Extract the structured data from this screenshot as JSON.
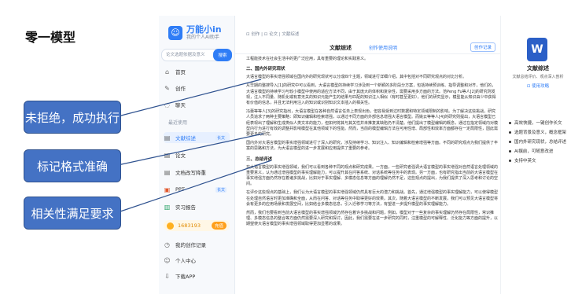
{
  "slide": {
    "title": "零一模型"
  },
  "app": {
    "logo_name": "万能小in",
    "logo_tagline": "我的个人AI助手",
    "search_placeholder": "论文选题依据及意义",
    "search_button": "搜索",
    "nav_top": [
      {
        "label": "首页",
        "icon": "home-icon"
      },
      {
        "label": "创作",
        "icon": "edit-icon"
      },
      {
        "label": "聊天",
        "icon": "chat-icon"
      }
    ],
    "recent_label": "最近使用",
    "recent_items": [
      {
        "label": "文献综述",
        "badge": "长文",
        "active": true
      },
      {
        "label": "论文",
        "badge": ""
      },
      {
        "label": "文档改写降重",
        "badge": ""
      },
      {
        "label": "PPT",
        "badge": "长文"
      },
      {
        "label": "实习报告",
        "badge": ""
      }
    ],
    "points": {
      "value": "1683193",
      "button": "充值"
    },
    "nav_bottom": [
      {
        "label": "我的创作记录"
      },
      {
        "label": "个人中心"
      },
      {
        "label": "下载APP"
      }
    ]
  },
  "doc": {
    "breadcrumb": "⊡ 创作  |  ⊡ 论文  |  文献综述",
    "title": "文献综述",
    "link": "创作使用说明",
    "action_button": "创作记录",
    "paragraphs": [
      {
        "kind": "p",
        "text": "工程能技术在社会生活中的更广泛应用，具有重要的理论和实践意义。"
      },
      {
        "kind": "h",
        "text": "二、国内外研究现状"
      },
      {
        "kind": "p",
        "text": "大语言模型的事实增强领域在国内外的研究现状可以分成四个主题，领域进行详细介绍，其中包括对不同研究观点的对比分析。"
      },
      {
        "kind": "p",
        "text": "从早期的整搜导入[1]的研究中可以看到，大语言模型的持续学习涉及到一个新颖的多阶段分方案，包括持续预训练、指导调整和对齐，他们的，大语言模型的持续学习与较小模型中使用的适应方法不同，由于其庞大的体积和复杂性，需要采用多方面的方法。范Peng Fu等人[2]的研究则发现，注入不同量、随机化或有意无关的知识元能产生的结果与匹配的知识注入相似（有时甚至更好），他们的研究显示，模型能从知识由少中获得有价值的信息，并且无法利用注入的知识或识别知识文本插入的相关性。"
      },
      {
        "kind": "p",
        "text": "冯蕾等等人[3]的研究指出，大语言模型在各种自然语言任务上表现出色，但容易受到过时数据和特定领域限制的影响。为了解决这些挑战，研究人员追求了两种主要策略：即知识编辑和检索增强，以通过不同方面的外部信息增强大语言模型。而姚云等等人[4]的研究则提出，大语言模型已经表现出了理解和生成类似人类文本的能力，但如何将其与其关性并未推复其缺陷仍不清楚。他们提出了模型编辑的概念，通过在指定领域内对模型内行为进行有效的调整并影响模型在其他领域下的性能。然而，当前的模型编辑方法在可用性增、局部性和效率方面都存在一定局限性，因此需要更多的研究。"
      },
      {
        "kind": "p",
        "text": "国内外对大语言模型的事实增强领域进行了深入的研究，涉及持续学习、知识注入、知识编辑和检索增强等方面。不同的研究观点为我们提供了丰富的思路和方法，为大语言模型的进一步发展和应用提供了重要的参考。"
      },
      {
        "kind": "h",
        "text": "三、总结评述"
      },
      {
        "kind": "p",
        "text": "在大语言模型的事实增强领域，我们可以看到各种不同的观点和研究成果。一方面，一些研究者强调大语言模型的事实增强对自然语言处理领域的重要意义，认为通过增强模型的事实理解能力，可以提升其在问答系统、对话系统等任务中的表现。另一方面，也有研究指出当前的大语言模型在事实增强方面仍然存在着诸多挑战，比如对于事实理解、多模态信息等方面的理解仍然不足，这些观点的提出，为我们提供了深入思考和讨论的空间。"
      },
      {
        "kind": "p",
        "text": "在评价这些观点的基础上，我们认为大语言模型的事实增强领域仍然具有巨大的潜力和挑战。首先，通过增强模型的事实理解能力，可以使得模型在处理自然语言时更加准确和全面，从而在问答、对话等任务中取得更好的效果。其次，随着大语言模型的不断发展，我们可以预见大语言模型将会有更多的应用场景和发展空间，比如结合多模态信息，引入迁移学习等方法，有望进一步提升模型的事实理解能力。"
      },
      {
        "kind": "p",
        "text": "然而，我们也要看到当前大语言模型的事实增强领域仍然存在着许多挑战和问题，例如，模型对于一些复杂的事实理解仍然存在局限性，常识推理、多模态信息的整合等方面仍然需要深入研究和探讨，因此，我们需要在进一步研究的同时，注重模型的可解释性、泛化能力等方面的提升，以期望使大语言模型的事实增强领域取得更加显著的成果。"
      }
    ]
  },
  "right_panel": {
    "icon": "word-icon",
    "title": "文献综述",
    "desc": "文献总结评价、观点深入剖析",
    "link": "⊡ 使用攻略",
    "features": [
      "高效快捷，一键创作长文",
      "选题背景及意义，概念框架",
      "国内外研究现状，总结评述",
      "AI撰前，可随意改进",
      "支持中英文"
    ]
  },
  "callouts": [
    {
      "text": "未拒绝，成功执行"
    },
    {
      "text": "标记格式准确"
    },
    {
      "text": "相关性满足要求"
    }
  ],
  "colors": {
    "accent": "#2f7df6",
    "callout": "#4472c4",
    "callout_border": "#2f528f"
  }
}
